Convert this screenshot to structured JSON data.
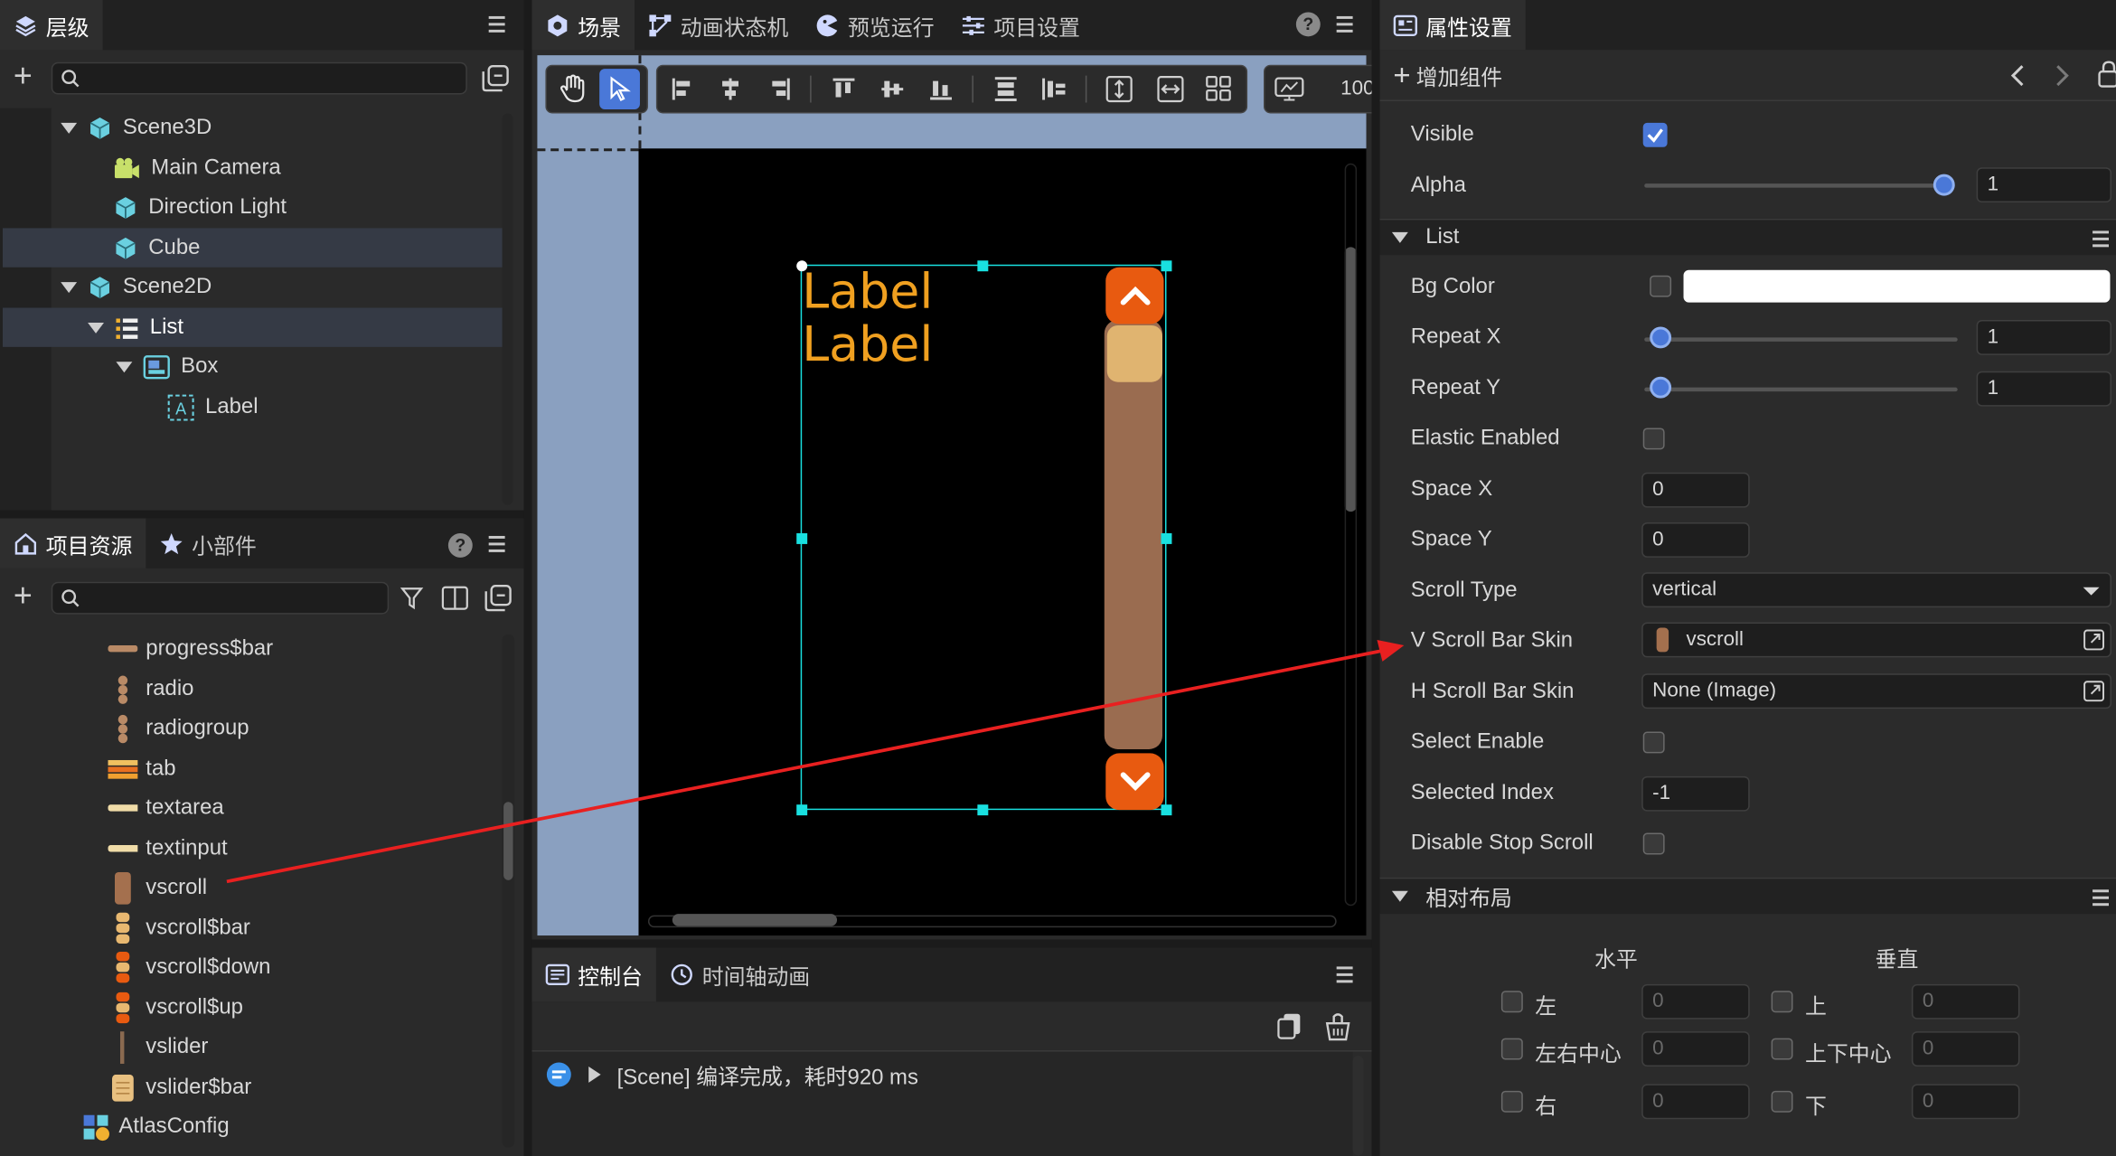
{
  "hierarchy": {
    "title": "层级",
    "items": [
      {
        "label": "Scene3D",
        "icon": "cube-icon"
      },
      {
        "label": "Main Camera",
        "icon": "camera-icon"
      },
      {
        "label": "Direction Light",
        "icon": "cube-icon"
      },
      {
        "label": "Cube",
        "icon": "cube-icon"
      },
      {
        "label": "Scene2D",
        "icon": "cube-icon"
      },
      {
        "label": "List",
        "icon": "list-icon"
      },
      {
        "label": "Box",
        "icon": "box-icon"
      },
      {
        "label": "Label",
        "icon": "label-icon"
      }
    ]
  },
  "resources": {
    "tab1": "项目资源",
    "tab2": "小部件",
    "items": [
      "progress$bar",
      "radio",
      "radiogroup",
      "tab",
      "textarea",
      "textinput",
      "vscroll",
      "vscroll$bar",
      "vscroll$down",
      "vscroll$up",
      "vslider",
      "vslider$bar",
      "AtlasConfig"
    ]
  },
  "center": {
    "tabs": [
      "场景",
      "动画状态机",
      "预览运行",
      "项目设置"
    ],
    "zoom": "100",
    "labels": [
      "Label",
      "Label"
    ]
  },
  "console": {
    "tab1": "控制台",
    "tab2": "时间轴动画",
    "message": "[Scene] 编译完成，耗时920 ms"
  },
  "inspector": {
    "title": "属性设置",
    "add_component": "增加组件",
    "visible_label": "Visible",
    "alpha_label": "Alpha",
    "alpha_value": "1",
    "alpha_level": 1.0,
    "list_section": "List",
    "bg_color_label": "Bg Color",
    "bg_color_value": "#ffffff",
    "repeat_x_label": "Repeat X",
    "repeat_x_value": "1",
    "repeat_y_label": "Repeat Y",
    "repeat_y_value": "1",
    "elastic_label": "Elastic Enabled",
    "space_x_label": "Space X",
    "space_x_value": "0",
    "space_y_label": "Space Y",
    "space_y_value": "0",
    "scroll_type_label": "Scroll Type",
    "scroll_type_value": "vertical",
    "vscroll_skin_label": "V Scroll Bar Skin",
    "vscroll_skin_value": "vscroll",
    "hscroll_skin_label": "H Scroll Bar Skin",
    "hscroll_skin_value": "None (Image)",
    "select_enable_label": "Select Enable",
    "selected_index_label": "Selected Index",
    "selected_index_value": "-1",
    "disable_stop_label": "Disable Stop Scroll",
    "layout_section": "相对布局",
    "horizontal": "水平",
    "vertical": "垂直",
    "left": "左",
    "center_h": "左右中心",
    "right": "右",
    "top": "上",
    "center_v": "上下中心",
    "bottom": "下",
    "zero": "0"
  },
  "colors": {
    "accent": "#4a78d8",
    "orange": "#e85a10",
    "label": "#f0a020",
    "arrow": "#e82020"
  }
}
